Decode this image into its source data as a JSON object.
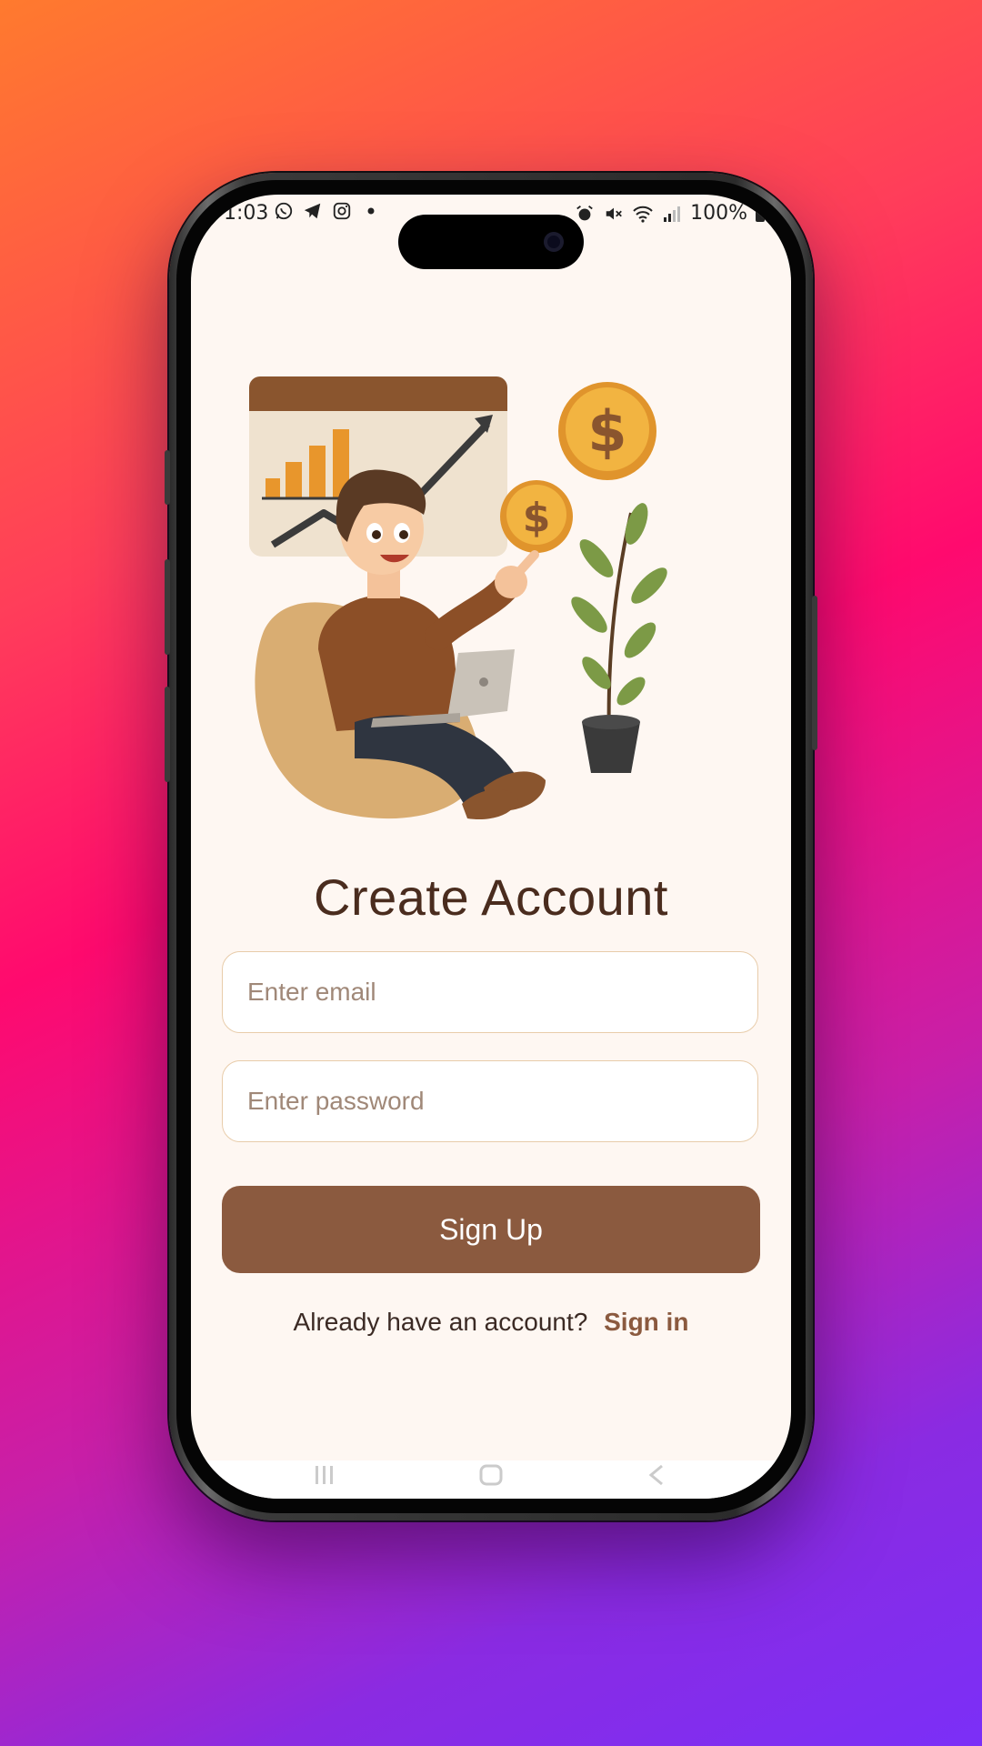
{
  "status_bar": {
    "time": "1:03",
    "left_icons": [
      "whatsapp-icon",
      "telegram-icon",
      "instagram-icon",
      "dot-icon"
    ],
    "right_icons": [
      "alarm-icon",
      "mute-icon",
      "wifi-icon",
      "signal-icon"
    ],
    "battery": "100%"
  },
  "signup": {
    "title": "Create Account",
    "email_placeholder": "Enter email",
    "password_placeholder": "Enter password",
    "button_label": "Sign Up",
    "prompt_text": "Already have an account?",
    "signin_link": "Sign in"
  },
  "colors": {
    "accent": "#8b5a3f",
    "title": "#4a2c1e",
    "screen_bg": "#fef7f2",
    "field_border": "#e8ccaa"
  }
}
